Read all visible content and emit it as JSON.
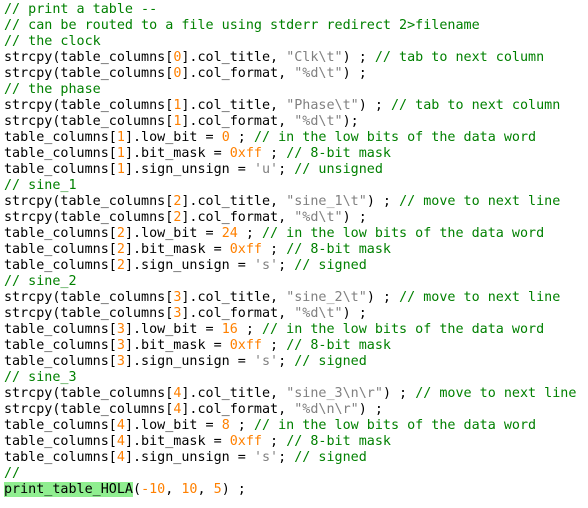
{
  "editor": {
    "lines": [
      [
        {
          "text": "// print a table --",
          "type": "comment"
        }
      ],
      [
        {
          "text": "// can be routed to a file using stderr redirect 2>filename",
          "type": "comment"
        }
      ],
      [
        {
          "text": "// the clock",
          "type": "comment"
        }
      ],
      [
        {
          "text": "strcpy(table_columns[",
          "type": "code"
        },
        {
          "text": "0",
          "type": "number"
        },
        {
          "text": "].col_title, ",
          "type": "code"
        },
        {
          "text": "\"Clk\\t\"",
          "type": "string"
        },
        {
          "text": ") ; ",
          "type": "code"
        },
        {
          "text": "// tab to next column",
          "type": "comment"
        }
      ],
      [
        {
          "text": "strcpy(table_columns[",
          "type": "code"
        },
        {
          "text": "0",
          "type": "number"
        },
        {
          "text": "].col_format, ",
          "type": "code"
        },
        {
          "text": "\"%d\\t\"",
          "type": "string"
        },
        {
          "text": ") ;",
          "type": "code"
        }
      ],
      [
        {
          "text": "// the phase",
          "type": "comment"
        }
      ],
      [
        {
          "text": "strcpy(table_columns[",
          "type": "code"
        },
        {
          "text": "1",
          "type": "number"
        },
        {
          "text": "].col_title, ",
          "type": "code"
        },
        {
          "text": "\"Phase\\t\"",
          "type": "string"
        },
        {
          "text": ") ; ",
          "type": "code"
        },
        {
          "text": "// tab to next column",
          "type": "comment"
        }
      ],
      [
        {
          "text": "strcpy(table_columns[",
          "type": "code"
        },
        {
          "text": "1",
          "type": "number"
        },
        {
          "text": "].col_format, ",
          "type": "code"
        },
        {
          "text": "\"%d\\t\"",
          "type": "string"
        },
        {
          "text": ");",
          "type": "code"
        }
      ],
      [
        {
          "text": "table_columns[",
          "type": "code"
        },
        {
          "text": "1",
          "type": "number"
        },
        {
          "text": "].low_bit = ",
          "type": "code"
        },
        {
          "text": "0",
          "type": "number"
        },
        {
          "text": " ; ",
          "type": "code"
        },
        {
          "text": "// in the low bits of the data word",
          "type": "comment"
        }
      ],
      [
        {
          "text": "table_columns[",
          "type": "code"
        },
        {
          "text": "1",
          "type": "number"
        },
        {
          "text": "].bit_mask = ",
          "type": "code"
        },
        {
          "text": "0xff",
          "type": "number"
        },
        {
          "text": " ; ",
          "type": "code"
        },
        {
          "text": "// 8-bit mask",
          "type": "comment"
        }
      ],
      [
        {
          "text": "table_columns[",
          "type": "code"
        },
        {
          "text": "1",
          "type": "number"
        },
        {
          "text": "].sign_unsign = ",
          "type": "code"
        },
        {
          "text": "'u'",
          "type": "string"
        },
        {
          "text": "; ",
          "type": "code"
        },
        {
          "text": "// unsigned",
          "type": "comment"
        }
      ],
      [
        {
          "text": "// sine_1",
          "type": "comment"
        }
      ],
      [
        {
          "text": "strcpy(table_columns[",
          "type": "code"
        },
        {
          "text": "2",
          "type": "number"
        },
        {
          "text": "].col_title, ",
          "type": "code"
        },
        {
          "text": "\"sine_1\\t\"",
          "type": "string"
        },
        {
          "text": ") ; ",
          "type": "code"
        },
        {
          "text": "// move to next line",
          "type": "comment"
        }
      ],
      [
        {
          "text": "strcpy(table_columns[",
          "type": "code"
        },
        {
          "text": "2",
          "type": "number"
        },
        {
          "text": "].col_format, ",
          "type": "code"
        },
        {
          "text": "\"%d\\t\"",
          "type": "string"
        },
        {
          "text": ") ;",
          "type": "code"
        }
      ],
      [
        {
          "text": "table_columns[",
          "type": "code"
        },
        {
          "text": "2",
          "type": "number"
        },
        {
          "text": "].low_bit = ",
          "type": "code"
        },
        {
          "text": "24",
          "type": "number"
        },
        {
          "text": " ; ",
          "type": "code"
        },
        {
          "text": "// in the low bits of the data word",
          "type": "comment"
        }
      ],
      [
        {
          "text": "table_columns[",
          "type": "code"
        },
        {
          "text": "2",
          "type": "number"
        },
        {
          "text": "].bit_mask = ",
          "type": "code"
        },
        {
          "text": "0xff",
          "type": "number"
        },
        {
          "text": " ; ",
          "type": "code"
        },
        {
          "text": "// 8-bit mask",
          "type": "comment"
        }
      ],
      [
        {
          "text": "table_columns[",
          "type": "code"
        },
        {
          "text": "2",
          "type": "number"
        },
        {
          "text": "].sign_unsign = ",
          "type": "code"
        },
        {
          "text": "'s'",
          "type": "string"
        },
        {
          "text": "; ",
          "type": "code"
        },
        {
          "text": "// signed",
          "type": "comment"
        }
      ],
      [
        {
          "text": "// sine_2",
          "type": "comment"
        }
      ],
      [
        {
          "text": "strcpy(table_columns[",
          "type": "code"
        },
        {
          "text": "3",
          "type": "number"
        },
        {
          "text": "].col_title, ",
          "type": "code"
        },
        {
          "text": "\"sine_2\\t\"",
          "type": "string"
        },
        {
          "text": ") ; ",
          "type": "code"
        },
        {
          "text": "// move to next line",
          "type": "comment"
        }
      ],
      [
        {
          "text": "strcpy(table_columns[",
          "type": "code"
        },
        {
          "text": "3",
          "type": "number"
        },
        {
          "text": "].col_format, ",
          "type": "code"
        },
        {
          "text": "\"%d\\t\"",
          "type": "string"
        },
        {
          "text": ") ;",
          "type": "code"
        }
      ],
      [
        {
          "text": "table_columns[",
          "type": "code"
        },
        {
          "text": "3",
          "type": "number"
        },
        {
          "text": "].low_bit = ",
          "type": "code"
        },
        {
          "text": "16",
          "type": "number"
        },
        {
          "text": " ; ",
          "type": "code"
        },
        {
          "text": "// in the low bits of the data word",
          "type": "comment"
        }
      ],
      [
        {
          "text": "table_columns[",
          "type": "code"
        },
        {
          "text": "3",
          "type": "number"
        },
        {
          "text": "].bit_mask = ",
          "type": "code"
        },
        {
          "text": "0xff",
          "type": "number"
        },
        {
          "text": " ; ",
          "type": "code"
        },
        {
          "text": "// 8-bit mask",
          "type": "comment"
        }
      ],
      [
        {
          "text": "table_columns[",
          "type": "code"
        },
        {
          "text": "3",
          "type": "number"
        },
        {
          "text": "].sign_unsign = ",
          "type": "code"
        },
        {
          "text": "'s'",
          "type": "string"
        },
        {
          "text": "; ",
          "type": "code"
        },
        {
          "text": "// signed",
          "type": "comment"
        }
      ],
      [
        {
          "text": "// sine_3",
          "type": "comment"
        }
      ],
      [
        {
          "text": "strcpy(table_columns[",
          "type": "code"
        },
        {
          "text": "4",
          "type": "number"
        },
        {
          "text": "].col_title, ",
          "type": "code"
        },
        {
          "text": "\"sine_3\\n\\r\"",
          "type": "string"
        },
        {
          "text": ") ; ",
          "type": "code"
        },
        {
          "text": "// move to next line",
          "type": "comment"
        }
      ],
      [
        {
          "text": "strcpy(table_columns[",
          "type": "code"
        },
        {
          "text": "4",
          "type": "number"
        },
        {
          "text": "].col_format, ",
          "type": "code"
        },
        {
          "text": "\"%d\\n\\r\"",
          "type": "string"
        },
        {
          "text": ") ;",
          "type": "code"
        }
      ],
      [
        {
          "text": "table_columns[",
          "type": "code"
        },
        {
          "text": "4",
          "type": "number"
        },
        {
          "text": "].low_bit = ",
          "type": "code"
        },
        {
          "text": "8",
          "type": "number"
        },
        {
          "text": " ; ",
          "type": "code"
        },
        {
          "text": "// in the low bits of the data word",
          "type": "comment"
        }
      ],
      [
        {
          "text": "table_columns[",
          "type": "code"
        },
        {
          "text": "4",
          "type": "number"
        },
        {
          "text": "].bit_mask = ",
          "type": "code"
        },
        {
          "text": "0xff",
          "type": "number"
        },
        {
          "text": " ; ",
          "type": "code"
        },
        {
          "text": "// 8-bit mask",
          "type": "comment"
        }
      ],
      [
        {
          "text": "table_columns[",
          "type": "code"
        },
        {
          "text": "4",
          "type": "number"
        },
        {
          "text": "].sign_unsign = ",
          "type": "code"
        },
        {
          "text": "'s'",
          "type": "string"
        },
        {
          "text": "; ",
          "type": "code"
        },
        {
          "text": "// signed",
          "type": "comment"
        }
      ],
      [
        {
          "text": "//",
          "type": "comment"
        }
      ],
      [
        {
          "text": "print_table_HOLA",
          "type": "func-hl"
        },
        {
          "text": "(",
          "type": "code"
        },
        {
          "text": "-10",
          "type": "number"
        },
        {
          "text": ", ",
          "type": "code"
        },
        {
          "text": "10",
          "type": "number"
        },
        {
          "text": ", ",
          "type": "code"
        },
        {
          "text": "5",
          "type": "number"
        },
        {
          "text": ") ;",
          "type": "code"
        }
      ]
    ]
  },
  "colors": {
    "background": "#ffffff",
    "code": "#000000",
    "comment": "#008000",
    "string": "#808080",
    "number": "#ff8000",
    "highlight": "#90ee90"
  }
}
